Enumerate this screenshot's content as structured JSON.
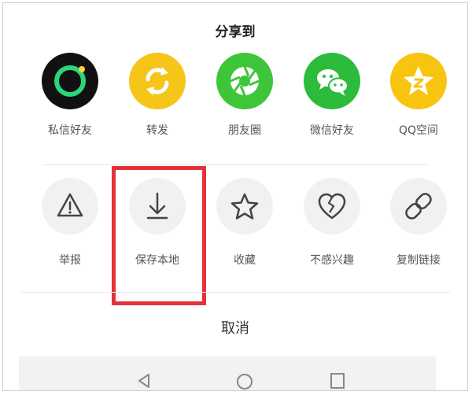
{
  "sheet": {
    "title": "分享到",
    "cancel_label": "取消"
  },
  "share_targets": [
    {
      "label": "私信好友",
      "icon": "private-message-icon",
      "color": "#111111"
    },
    {
      "label": "转发",
      "icon": "repost-icon",
      "color": "#f5c518"
    },
    {
      "label": "朋友圈",
      "icon": "wechat-moments-icon",
      "color": "#3ec53a"
    },
    {
      "label": "微信好友",
      "icon": "wechat-icon",
      "color": "#2dbb3c"
    },
    {
      "label": "QQ空间",
      "icon": "qzone-icon",
      "color": "#f8c40f"
    }
  ],
  "actions": [
    {
      "label": "举报",
      "icon": "warning-icon"
    },
    {
      "label": "保存本地",
      "icon": "download-icon"
    },
    {
      "label": "收藏",
      "icon": "star-icon"
    },
    {
      "label": "不感兴趣",
      "icon": "broken-heart-icon"
    },
    {
      "label": "复制链接",
      "icon": "link-icon"
    }
  ],
  "colors": {
    "highlight": "#e5323a",
    "action_circle": "#f1f1f1"
  }
}
